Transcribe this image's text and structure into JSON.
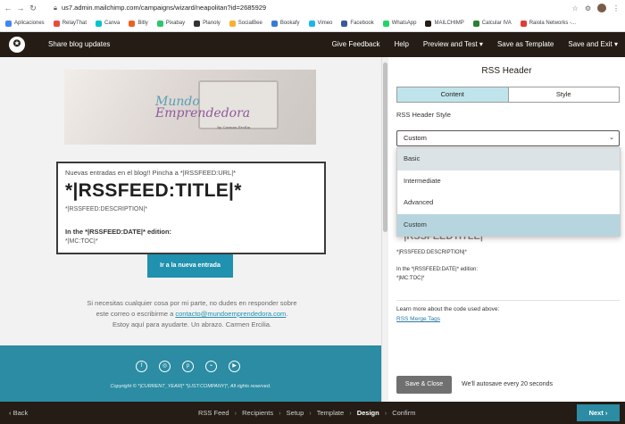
{
  "browser": {
    "url": "us7.admin.mailchimp.com/campaigns/wizard/neapolitan?id=2685929",
    "bookmarks": [
      {
        "label": "Aplicaciones",
        "color": "#4285f4"
      },
      {
        "label": "RelayThat",
        "color": "#e84c3d"
      },
      {
        "label": "Canva",
        "color": "#00c4cc"
      },
      {
        "label": "Bitly",
        "color": "#ee6123"
      },
      {
        "label": "Pixabay",
        "color": "#2ec66d"
      },
      {
        "label": "Planoly",
        "color": "#333333"
      },
      {
        "label": "SocialBee",
        "color": "#f9b233"
      },
      {
        "label": "Bookafy",
        "color": "#3a7bd5"
      },
      {
        "label": "Vimeo",
        "color": "#1ab7ea"
      },
      {
        "label": "Facebook",
        "color": "#3b5998"
      },
      {
        "label": "WhatsApp",
        "color": "#25d366"
      },
      {
        "label": "MAILCHIMP",
        "color": "#241c15"
      },
      {
        "label": "Calcular IVA",
        "color": "#2e7d32"
      },
      {
        "label": "Raiola Networks -...",
        "color": "#e53935"
      }
    ]
  },
  "topbar": {
    "campaign_name": "Share blog updates",
    "actions": [
      "Give Feedback",
      "Help",
      "Preview and Test ▾",
      "Save as Template",
      "Save and Exit ▾"
    ]
  },
  "preview": {
    "logo_line1": "Mundo",
    "logo_line2": "Emprendedora",
    "logo_byline": "by Carmen Ercilia",
    "intro": "Nuevas entradas en el blog!! Pincha a *|RSSFEED:URL|*",
    "title": "*|RSSFEED:TITLE|*",
    "description": "*|RSSFEED:DESCRIPTION|*",
    "date_line": "In the *|RSSFEED:DATE|* edition:",
    "toc": "*|MC:TOC|*",
    "button": "Ir a la nueva entrada",
    "footer_line1": "Si necesitas cualquier cosa por mi parte, no dudes en responder sobre",
    "footer_line2a": "este correo o escribirme a ",
    "footer_email": "contacto@mundoemprendedora.com",
    "footer_line2b": ".",
    "footer_line3": "Estoy aquí para ayudarte. Un abrazo. Carmen Ercilia.",
    "copyright": "Copyright © *|CURRENT_YEAR|* *|LIST:COMPANY|*, All rights reserved."
  },
  "panel": {
    "title": "RSS Header",
    "tab_content": "Content",
    "tab_style": "Style",
    "style_label": "RSS Header Style",
    "selected_style": "Custom",
    "options": [
      "Basic",
      "Intermediate",
      "Advanced",
      "Custom"
    ],
    "title_ghost": "*|RSSFEEDTITLE|*",
    "desc": "*|RSSFEED:DESCRIPTION|*",
    "date_line": "In the *|RSSFEED:DATE|* edition:",
    "toc": "*|MC:TOC|*",
    "learn_more": "Learn more about the code used above:",
    "merge_link": "RSS Merge Tags",
    "save_close": "Save & Close",
    "autosave": "We'll autosave every 20 seconds"
  },
  "bottombar": {
    "back": "‹ Back",
    "steps": [
      "RSS Feed",
      "Recipients",
      "Setup",
      "Template",
      "Design",
      "Confirm"
    ],
    "current_step": "Design",
    "next": "Next ›"
  },
  "colors": {
    "accent": "#2b8ca3",
    "dark": "#241c15",
    "tab_active": "#bfe4ec"
  }
}
